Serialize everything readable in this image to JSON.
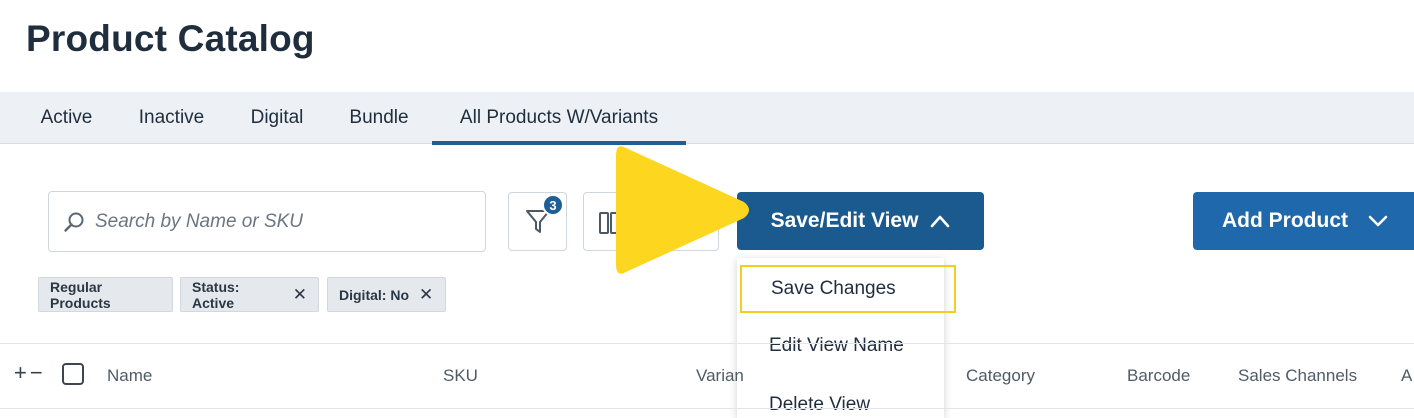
{
  "page": {
    "title": "Product Catalog"
  },
  "tabs": [
    {
      "label": "Active"
    },
    {
      "label": "Inactive"
    },
    {
      "label": "Digital"
    },
    {
      "label": "Bundle"
    },
    {
      "label": "All Products W/Variants",
      "active": true
    }
  ],
  "toolbar": {
    "search_placeholder": "Search by Name or SKU",
    "filter_count": "3",
    "save_view_label": "Save/Edit View",
    "add_product_label": "Add Product"
  },
  "dropdown": {
    "items": [
      {
        "label": "Save Changes"
      },
      {
        "label": "Edit View Name"
      },
      {
        "label": "Delete View"
      }
    ]
  },
  "chips": [
    {
      "label": "Regular Products"
    },
    {
      "label": "Status: Active"
    },
    {
      "label": "Digital: No"
    }
  ],
  "table": {
    "expander": "+−",
    "columns": [
      {
        "label": "Name"
      },
      {
        "label": "SKU"
      },
      {
        "label": "Varian"
      },
      {
        "label": "Category"
      },
      {
        "label": "Barcode"
      },
      {
        "label": "Sales Channels"
      },
      {
        "label": "A"
      }
    ]
  },
  "colors": {
    "primary": "#1b5a8e",
    "accent": "#1e68ab",
    "highlight": "#f3cc27",
    "overlay": "#fdd61f"
  },
  "icons": [
    "search-icon",
    "filter-icon",
    "columns-icon",
    "chevron-up-icon",
    "chevron-down-icon",
    "close-icon",
    "play-overlay-icon"
  ]
}
